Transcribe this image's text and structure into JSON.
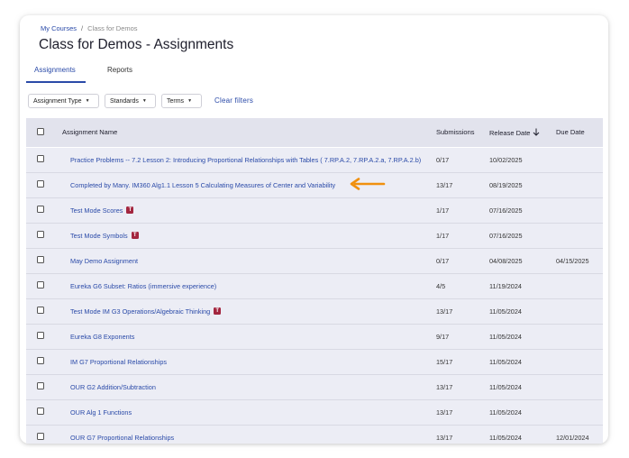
{
  "breadcrumb": {
    "parent": "My Courses",
    "separator": "/",
    "current": "Class for Demos"
  },
  "page_title": "Class for Demos - Assignments",
  "tabs": [
    {
      "label": "Assignments",
      "active": true
    },
    {
      "label": "Reports",
      "active": false
    }
  ],
  "filters": [
    {
      "label": "Assignment Type"
    },
    {
      "label": "Standards"
    },
    {
      "label": "Terms"
    }
  ],
  "clear_filters": "Clear filters",
  "table": {
    "columns": {
      "name": "Assignment Name",
      "submissions": "Submissions",
      "release_date": "Release Date",
      "due_date": "Due Date"
    },
    "sort_icon": "arrow-down-icon",
    "rows": [
      {
        "name": "Practice Problems -- 7.2 Lesson 2: Introducing Proportional Relationships with Tables ( 7.RP.A.2, 7.RP.A.2.a, 7.RP.A.2.b)",
        "badge": "",
        "submissions": "0/17",
        "release": "10/02/2025",
        "due": ""
      },
      {
        "name": "Completed by Many. IM360 Alg1.1 Lesson 5 Calculating Measures of Center and Variability",
        "badge": "",
        "submissions": "13/17",
        "release": "08/19/2025",
        "due": ""
      },
      {
        "name": "Test Mode Scores",
        "badge": "T",
        "submissions": "1/17",
        "release": "07/16/2025",
        "due": ""
      },
      {
        "name": "Test Mode Symbols",
        "badge": "T",
        "submissions": "1/17",
        "release": "07/16/2025",
        "due": ""
      },
      {
        "name": "May Demo Assignment",
        "badge": "",
        "submissions": "0/17",
        "release": "04/08/2025",
        "due": "04/15/2025"
      },
      {
        "name": "Eureka G6 Subset: Ratios (immersive experience)",
        "badge": "",
        "submissions": "4/5",
        "release": "11/19/2024",
        "due": ""
      },
      {
        "name": "Test Mode IM G3 Operations/Algebraic Thinking",
        "badge": "T",
        "submissions": "13/17",
        "release": "11/05/2024",
        "due": ""
      },
      {
        "name": "Eureka G8 Exponents",
        "badge": "",
        "submissions": "9/17",
        "release": "11/05/2024",
        "due": ""
      },
      {
        "name": "IM G7 Proportional Relationships",
        "badge": "",
        "submissions": "15/17",
        "release": "11/05/2024",
        "due": ""
      },
      {
        "name": "OUR G2 Addition/Subtraction",
        "badge": "",
        "submissions": "13/17",
        "release": "11/05/2024",
        "due": ""
      },
      {
        "name": "OUR Alg 1 Functions",
        "badge": "",
        "submissions": "13/17",
        "release": "11/05/2024",
        "due": ""
      },
      {
        "name": "OUR G7 Proportional Relationships",
        "badge": "",
        "submissions": "13/17",
        "release": "11/05/2024",
        "due": "12/01/2024"
      }
    ]
  },
  "annotation": {
    "icon": "arrow-left-icon",
    "color": "#f0900f"
  },
  "colors": {
    "accent": "#2a4aa8",
    "badge": "#a3263f",
    "header_bg": "#e2e3ed",
    "row_bg": "#ecedf5"
  }
}
